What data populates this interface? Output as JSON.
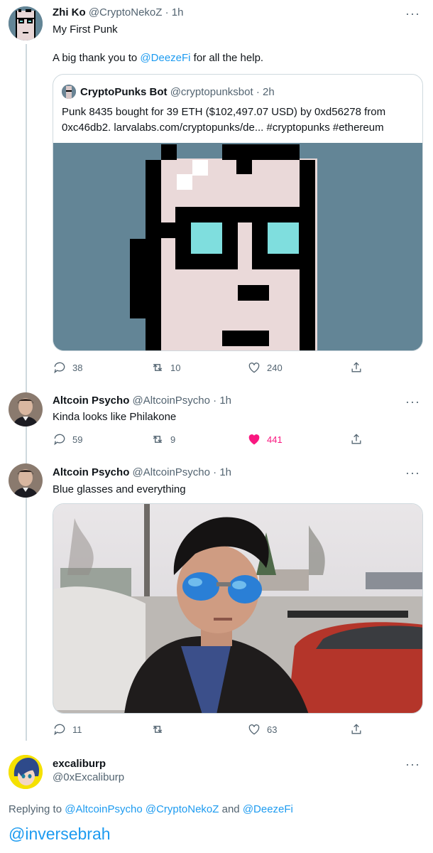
{
  "tweets": [
    {
      "name": "Zhi Ko",
      "handle": "@CryptoNekoZ",
      "time": "· 1h",
      "text1": "My First Punk",
      "text2_prefix": "A big thank you to ",
      "text2_mention": "@DeezeFi",
      "text2_suffix": " for all the help.",
      "more": "···",
      "replies": "38",
      "retweets": "10",
      "likes": "240"
    },
    {
      "name": "Altcoin Psycho",
      "handle": "@AltcoinPsycho",
      "time": "· 1h",
      "text": "Kinda looks like Philakone",
      "more": "···",
      "replies": "59",
      "retweets": "9",
      "likes": "441",
      "liked": true
    },
    {
      "name": "Altcoin Psycho",
      "handle": "@AltcoinPsycho",
      "time": "· 1h",
      "text": "Blue glasses and everything",
      "more": "···",
      "replies": "11",
      "retweets": "",
      "likes": "63"
    }
  ],
  "quote": {
    "name": "CryptoPunks Bot",
    "handle": "@cryptopunksbot",
    "time": "· 2h",
    "line1": "Punk 8435 bought for 39 ETH ($102,497.07 USD) by 0xd56278 from",
    "line2": "0xc46db2. larvalabs.com/cryptopunks/de... #cryptopunks #ethereum"
  },
  "reply": {
    "name": "excaliburp",
    "handle": "@0xExcaliburp",
    "more": "···",
    "replying_prefix": "Replying to ",
    "mention1": "@AltcoinPsycho",
    "mention2": "@CryptoNekoZ",
    "and": " and ",
    "mention3": "@DeezeFi",
    "body": "@inversebrah"
  },
  "colors": {
    "link": "#1d9bf0",
    "like_active": "#f91880",
    "punk_bg": "#638596",
    "punk_glasses": "#7fdede"
  },
  "icons": [
    "reply-icon",
    "retweet-icon",
    "like-icon",
    "share-icon",
    "more-icon"
  ]
}
